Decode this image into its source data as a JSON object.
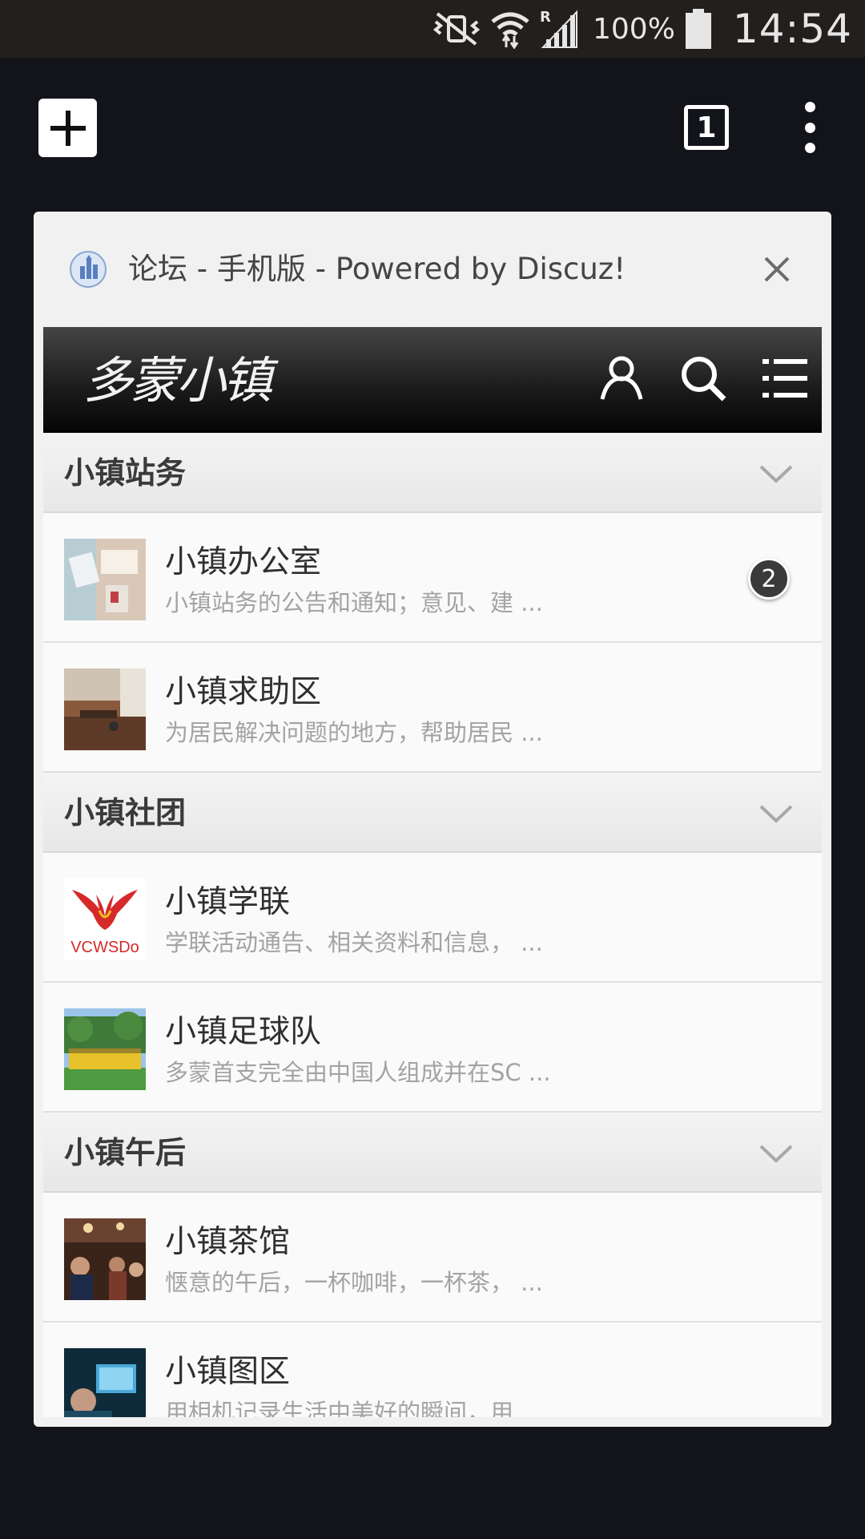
{
  "status_bar": {
    "battery_percent": "100%",
    "clock": "14:54",
    "icons": [
      "vibrate-mute-icon",
      "wifi-icon",
      "roaming-signal-icon",
      "battery-icon"
    ]
  },
  "toolbar": {
    "new_tab_icon": "plus-icon",
    "tab_count": "1",
    "menu_icon": "overflow-menu-icon"
  },
  "tab": {
    "title": "论坛 - 手机版 - Powered by Discuz!",
    "close_icon": "close-icon"
  },
  "site": {
    "logo_text": "多蒙小镇",
    "header_icons": [
      "user-icon",
      "search-icon",
      "list-menu-icon"
    ]
  },
  "sections": [
    {
      "title": "小镇站务",
      "forums": [
        {
          "name": "小镇办公室",
          "desc": "小镇站务的公告和通知；意见、建 ...",
          "badge": "2"
        },
        {
          "name": "小镇求助区",
          "desc": "为居民解决问题的地方，帮助居民 ...",
          "badge": ""
        }
      ]
    },
    {
      "title": "小镇社团",
      "forums": [
        {
          "name": "小镇学联",
          "desc": "学联活动通告、相关资料和信息， ...",
          "badge": "",
          "thumb_text": "VCWSDo"
        },
        {
          "name": "小镇足球队",
          "desc": "多蒙首支完全由中国人组成并在SC ...",
          "badge": ""
        }
      ]
    },
    {
      "title": "小镇午后",
      "forums": [
        {
          "name": "小镇茶馆",
          "desc": "惬意的午后，一杯咖啡，一杯茶， ...",
          "badge": ""
        },
        {
          "name": "小镇图区",
          "desc": "用相机记录生活中美好的瞬间，用 ...",
          "badge": ""
        }
      ]
    }
  ],
  "colors": {
    "background": "#121419",
    "status_bar": "#221f1d",
    "card": "#f1f1f1",
    "site_header": "#1a1a1a",
    "badge": "#3a3a3a"
  }
}
